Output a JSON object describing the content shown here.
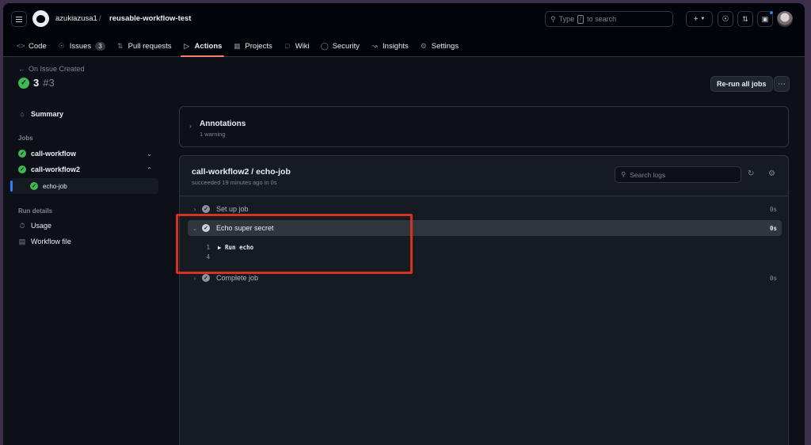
{
  "header": {
    "owner": "azukiazusa1",
    "separator": "/",
    "repo": "reusable-workflow-test",
    "search_prefix": "Type",
    "search_key": "/",
    "search_suffix": "to search"
  },
  "nav": [
    {
      "label": "Code",
      "icon": "code-icon"
    },
    {
      "label": "Issues",
      "icon": "issue-icon",
      "count": "3"
    },
    {
      "label": "Pull requests",
      "icon": "pull-request-icon"
    },
    {
      "label": "Actions",
      "icon": "play-icon",
      "active": true
    },
    {
      "label": "Projects",
      "icon": "table-icon"
    },
    {
      "label": "Wiki",
      "icon": "book-icon"
    },
    {
      "label": "Security",
      "icon": "shield-icon"
    },
    {
      "label": "Insights",
      "icon": "graph-icon"
    },
    {
      "label": "Settings",
      "icon": "gear-icon"
    }
  ],
  "run": {
    "back_label": "On Issue Created",
    "number": "3",
    "hash": "#3",
    "rerun_label": "Re-run all jobs"
  },
  "sidebar": {
    "summary": "Summary",
    "jobs_heading": "Jobs",
    "jobs": [
      {
        "label": "call-workflow",
        "status": "success",
        "expanded": false
      },
      {
        "label": "call-workflow2",
        "status": "success",
        "expanded": true
      }
    ],
    "sub_job": "echo-job",
    "run_details_heading": "Run details",
    "usage": "Usage",
    "workflow_file": "Workflow file"
  },
  "annotations": {
    "title": "Annotations",
    "subtitle": "1 warning"
  },
  "job": {
    "title": "call-workflow2 / echo-job",
    "subtitle": "succeeded 19 minutes ago in 0s",
    "search_placeholder": "Search logs",
    "steps": [
      {
        "label": "Set up job",
        "time": "0s"
      },
      {
        "label": "Echo super secret",
        "time": "0s"
      },
      {
        "label": "Complete job",
        "time": "0s"
      }
    ],
    "log_lines": [
      {
        "num": "1",
        "text": "▶ Run echo"
      },
      {
        "num": "4",
        "text": ""
      }
    ]
  },
  "colors": {
    "accent": "#f78166",
    "success": "#3fb950",
    "highlight_box": "#d7321f"
  }
}
